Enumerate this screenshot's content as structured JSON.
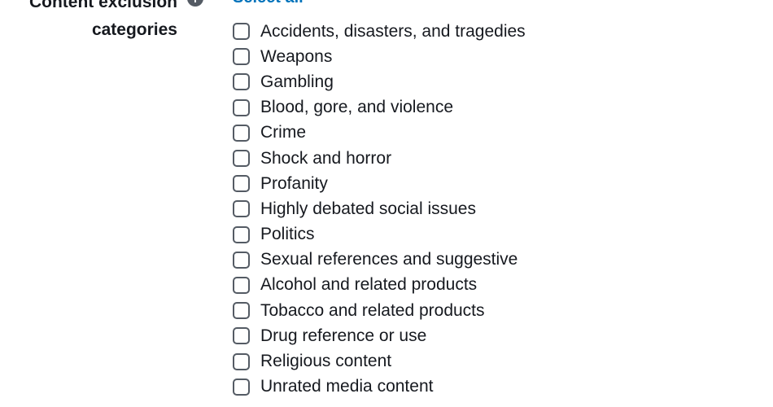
{
  "field": {
    "label_line1": "Content exclusion",
    "label_line2": "categories",
    "info_icon": "info-icon",
    "select_all_label": "Select all"
  },
  "categories": [
    {
      "label": "Accidents, disasters, and tragedies",
      "checked": false
    },
    {
      "label": "Weapons",
      "checked": false
    },
    {
      "label": "Gambling",
      "checked": false
    },
    {
      "label": "Blood, gore, and violence",
      "checked": false
    },
    {
      "label": "Crime",
      "checked": false
    },
    {
      "label": "Shock and horror",
      "checked": false
    },
    {
      "label": "Profanity",
      "checked": false
    },
    {
      "label": "Highly debated social issues",
      "checked": false
    },
    {
      "label": "Politics",
      "checked": false
    },
    {
      "label": "Sexual references and suggestive",
      "checked": false
    },
    {
      "label": "Alcohol and related products",
      "checked": false
    },
    {
      "label": "Tobacco and related products",
      "checked": false
    },
    {
      "label": "Drug reference or use",
      "checked": false
    },
    {
      "label": "Religious content",
      "checked": false
    },
    {
      "label": "Unrated media content",
      "checked": false
    }
  ],
  "colors": {
    "link": "#0073bb",
    "text": "#16191f",
    "checkbox_border": "#545b64"
  }
}
